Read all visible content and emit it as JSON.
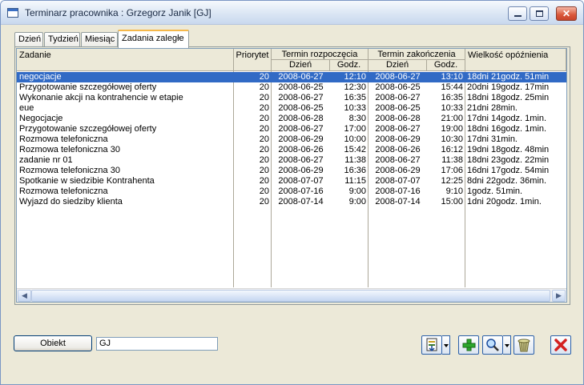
{
  "window": {
    "title": "Terminarz pracownika : Grzegorz Janik [GJ]"
  },
  "tabs": [
    {
      "label": "Dzień"
    },
    {
      "label": "Tydzień"
    },
    {
      "label": "Miesiąc"
    },
    {
      "label": "Zadania zaległe"
    }
  ],
  "grid": {
    "headers": {
      "zadanie": "Zadanie",
      "priorytet": "Priorytet",
      "termin_rozpoczecia": "Termin rozpoczęcia",
      "termin_zakonczenia": "Termin zakończenia",
      "dzien": "Dzień",
      "godz": "Godz.",
      "wielkosc_opoznienia": "Wielkość opóźnienia"
    },
    "rows": [
      {
        "zadanie": "negocjacje",
        "priorytet": "20",
        "start_dzien": "2008-06-27",
        "start_godz": "12:10",
        "end_dzien": "2008-06-27",
        "end_godz": "13:10",
        "opoznienie": "18dni 21godz. 51min"
      },
      {
        "zadanie": "Przygotowanie szczegółowej oferty",
        "priorytet": "20",
        "start_dzien": "2008-06-25",
        "start_godz": "12:30",
        "end_dzien": "2008-06-25",
        "end_godz": "15:44",
        "opoznienie": "20dni 19godz. 17min"
      },
      {
        "zadanie": "Wykonanie akcji na kontrahencie w etapie",
        "priorytet": "20",
        "start_dzien": "2008-06-27",
        "start_godz": "16:35",
        "end_dzien": "2008-06-27",
        "end_godz": "16:35",
        "opoznienie": "18dni 18godz. 25min"
      },
      {
        "zadanie": "eue",
        "priorytet": "20",
        "start_dzien": "2008-06-25",
        "start_godz": "10:33",
        "end_dzien": "2008-06-25",
        "end_godz": "10:33",
        "opoznienie": "21dni 28min."
      },
      {
        "zadanie": "Negocjacje",
        "priorytet": "20",
        "start_dzien": "2008-06-28",
        "start_godz": "8:30",
        "end_dzien": "2008-06-28",
        "end_godz": "21:00",
        "opoznienie": "17dni 14godz. 1min."
      },
      {
        "zadanie": "Przygotowanie szczegółowej oferty",
        "priorytet": "20",
        "start_dzien": "2008-06-27",
        "start_godz": "17:00",
        "end_dzien": "2008-06-27",
        "end_godz": "19:00",
        "opoznienie": "18dni 16godz. 1min."
      },
      {
        "zadanie": "Rozmowa telefoniczna",
        "priorytet": "20",
        "start_dzien": "2008-06-29",
        "start_godz": "10:00",
        "end_dzien": "2008-06-29",
        "end_godz": "10:30",
        "opoznienie": "17dni 31min."
      },
      {
        "zadanie": "Rozmowa telefoniczna 30",
        "priorytet": "20",
        "start_dzien": "2008-06-26",
        "start_godz": "15:42",
        "end_dzien": "2008-06-26",
        "end_godz": "16:12",
        "opoznienie": "19dni 18godz. 48min"
      },
      {
        "zadanie": "zadanie nr 01",
        "priorytet": "20",
        "start_dzien": "2008-06-27",
        "start_godz": "11:38",
        "end_dzien": "2008-06-27",
        "end_godz": "11:38",
        "opoznienie": "18dni 23godz. 22min"
      },
      {
        "zadanie": "Rozmowa telefoniczna 30",
        "priorytet": "20",
        "start_dzien": "2008-06-29",
        "start_godz": "16:36",
        "end_dzien": "2008-06-29",
        "end_godz": "17:06",
        "opoznienie": "16dni 17godz. 54min"
      },
      {
        "zadanie": "Spotkanie w siedzibie Kontrahenta",
        "priorytet": "20",
        "start_dzien": "2008-07-07",
        "start_godz": "11:15",
        "end_dzien": "2008-07-07",
        "end_godz": "12:25",
        "opoznienie": "8dni 22godz. 36min."
      },
      {
        "zadanie": "Rozmowa telefoniczna",
        "priorytet": "20",
        "start_dzien": "2008-07-16",
        "start_godz": "9:00",
        "end_dzien": "2008-07-16",
        "end_godz": "9:10",
        "opoznienie": "1godz. 51min."
      },
      {
        "zadanie": "Wyjazd do siedziby klienta",
        "priorytet": "20",
        "start_dzien": "2008-07-14",
        "start_godz": "9:00",
        "end_dzien": "2008-07-14",
        "end_godz": "15:00",
        "opoznienie": "1dni 20godz. 1min."
      }
    ],
    "selected_row": 0
  },
  "footer": {
    "obiekt_button": "Obiekt",
    "obiekt_value": "GJ"
  },
  "colors": {
    "selection": "#316ac5",
    "active_tab_accent": "#f6b84a"
  }
}
